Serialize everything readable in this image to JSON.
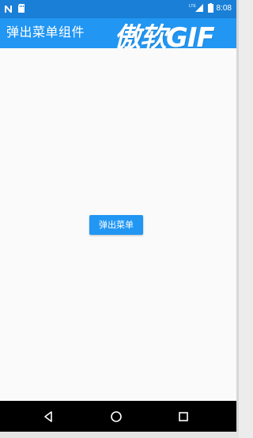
{
  "status_bar": {
    "time": "8:08",
    "network": "LTE",
    "icons": [
      "n-notification-icon",
      "sd-card-icon",
      "lte-signal-icon",
      "battery-icon"
    ]
  },
  "app_bar": {
    "title": "弹出菜单组件"
  },
  "watermark": {
    "text": "傲软GIF"
  },
  "main": {
    "popup_button_label": "弹出菜单"
  },
  "navigation": {
    "items": [
      "back-icon",
      "home-icon",
      "recent-apps-icon"
    ]
  },
  "colors": {
    "primary": "#2196f3",
    "status_bar": "#1a7fd7",
    "background": "#fafafa",
    "nav_bar": "#000000"
  }
}
